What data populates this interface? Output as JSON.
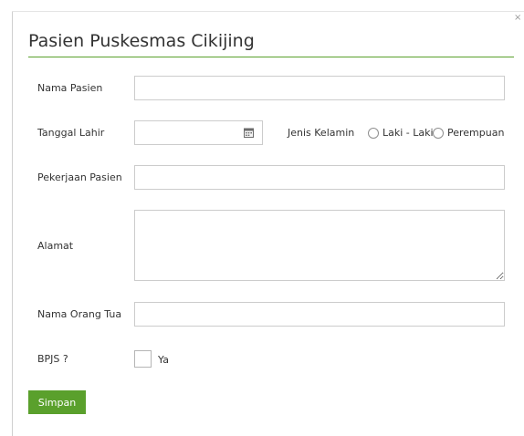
{
  "dialog": {
    "title": "Pasien Puskesmas Cikijing",
    "close_glyph": "×"
  },
  "form": {
    "nama_pasien": {
      "label": "Nama Pasien",
      "value": "",
      "placeholder": ""
    },
    "tanggal_lahir": {
      "label": "Tanggal Lahir",
      "value": "",
      "placeholder": "",
      "icon": "calendar-icon"
    },
    "jenis_kelamin": {
      "label": "Jenis Kelamin",
      "options": [
        "Laki - Laki",
        "Perempuan"
      ],
      "selected": null
    },
    "pekerjaan_pasien": {
      "label": "Pekerjaan Pasien",
      "value": "",
      "placeholder": ""
    },
    "alamat": {
      "label": "Alamat",
      "value": "",
      "placeholder": ""
    },
    "nama_orang_tua": {
      "label": "Nama Orang Tua",
      "value": "",
      "placeholder": ""
    },
    "bpjs": {
      "label": "BPJS ?",
      "option_label": "Ya",
      "checked": false
    },
    "submit_label": "Simpan"
  },
  "colors": {
    "accent": "#5aa02c",
    "border": "#cccccc",
    "text": "#333333"
  }
}
